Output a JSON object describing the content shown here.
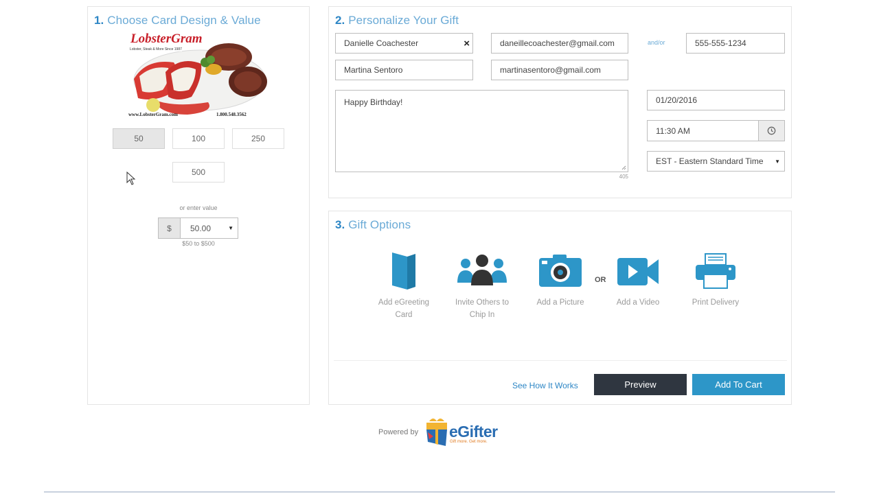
{
  "card_design": {
    "step_number": "1.",
    "title": "Choose Card Design & Value",
    "card": {
      "brand": "LobsterGram",
      "tagline": "Lobster, Steak & More Since 1987",
      "website": "www.LobsterGram.com",
      "phone": "1.800.548.3562"
    },
    "values": [
      "50",
      "100",
      "250",
      "500"
    ],
    "selected_value": "50",
    "or_enter_label": "or enter value",
    "currency_symbol": "$",
    "custom_value": "50.00",
    "range_label": "$50 to $500"
  },
  "personalize": {
    "step_number": "2.",
    "title": "Personalize Your Gift",
    "recipient_name": "Danielle Coachester",
    "clear_symbol": "×",
    "recipient_email": "daneillecoachester@gmail.com",
    "andor_label": "and/or",
    "recipient_phone": "555-555-1234",
    "sender_name": "Martina Sentoro",
    "sender_email": "martinasentoro@gmail.com",
    "message": "Happy Birthday!",
    "char_count": "405",
    "delivery_date": "01/20/2016",
    "delivery_time": "11:30 AM",
    "timezone": "EST - Eastern Standard Time"
  },
  "gift_options": {
    "step_number": "3.",
    "title": "Gift Options",
    "or_label": "OR",
    "options": [
      {
        "label": "Add eGreeting Card",
        "icon": "greeting-card-icon"
      },
      {
        "label": "Invite Others to Chip In",
        "icon": "group-icon"
      },
      {
        "label": "Add a Picture",
        "icon": "camera-icon"
      },
      {
        "label": "Add a Video",
        "icon": "video-camera-icon"
      },
      {
        "label": "Print Delivery",
        "icon": "printer-icon"
      }
    ],
    "see_how_label": "See How It Works",
    "preview_label": "Preview",
    "add_to_cart_label": "Add To Cart"
  },
  "footer": {
    "powered_by": "Powered by",
    "brand": "eGifter",
    "tagline": "Gift more. Get more."
  },
  "colors": {
    "accent": "#2d96c8",
    "title": "#6aaad6",
    "dark_button": "#2f3640",
    "primary_button": "#2d96c8"
  }
}
